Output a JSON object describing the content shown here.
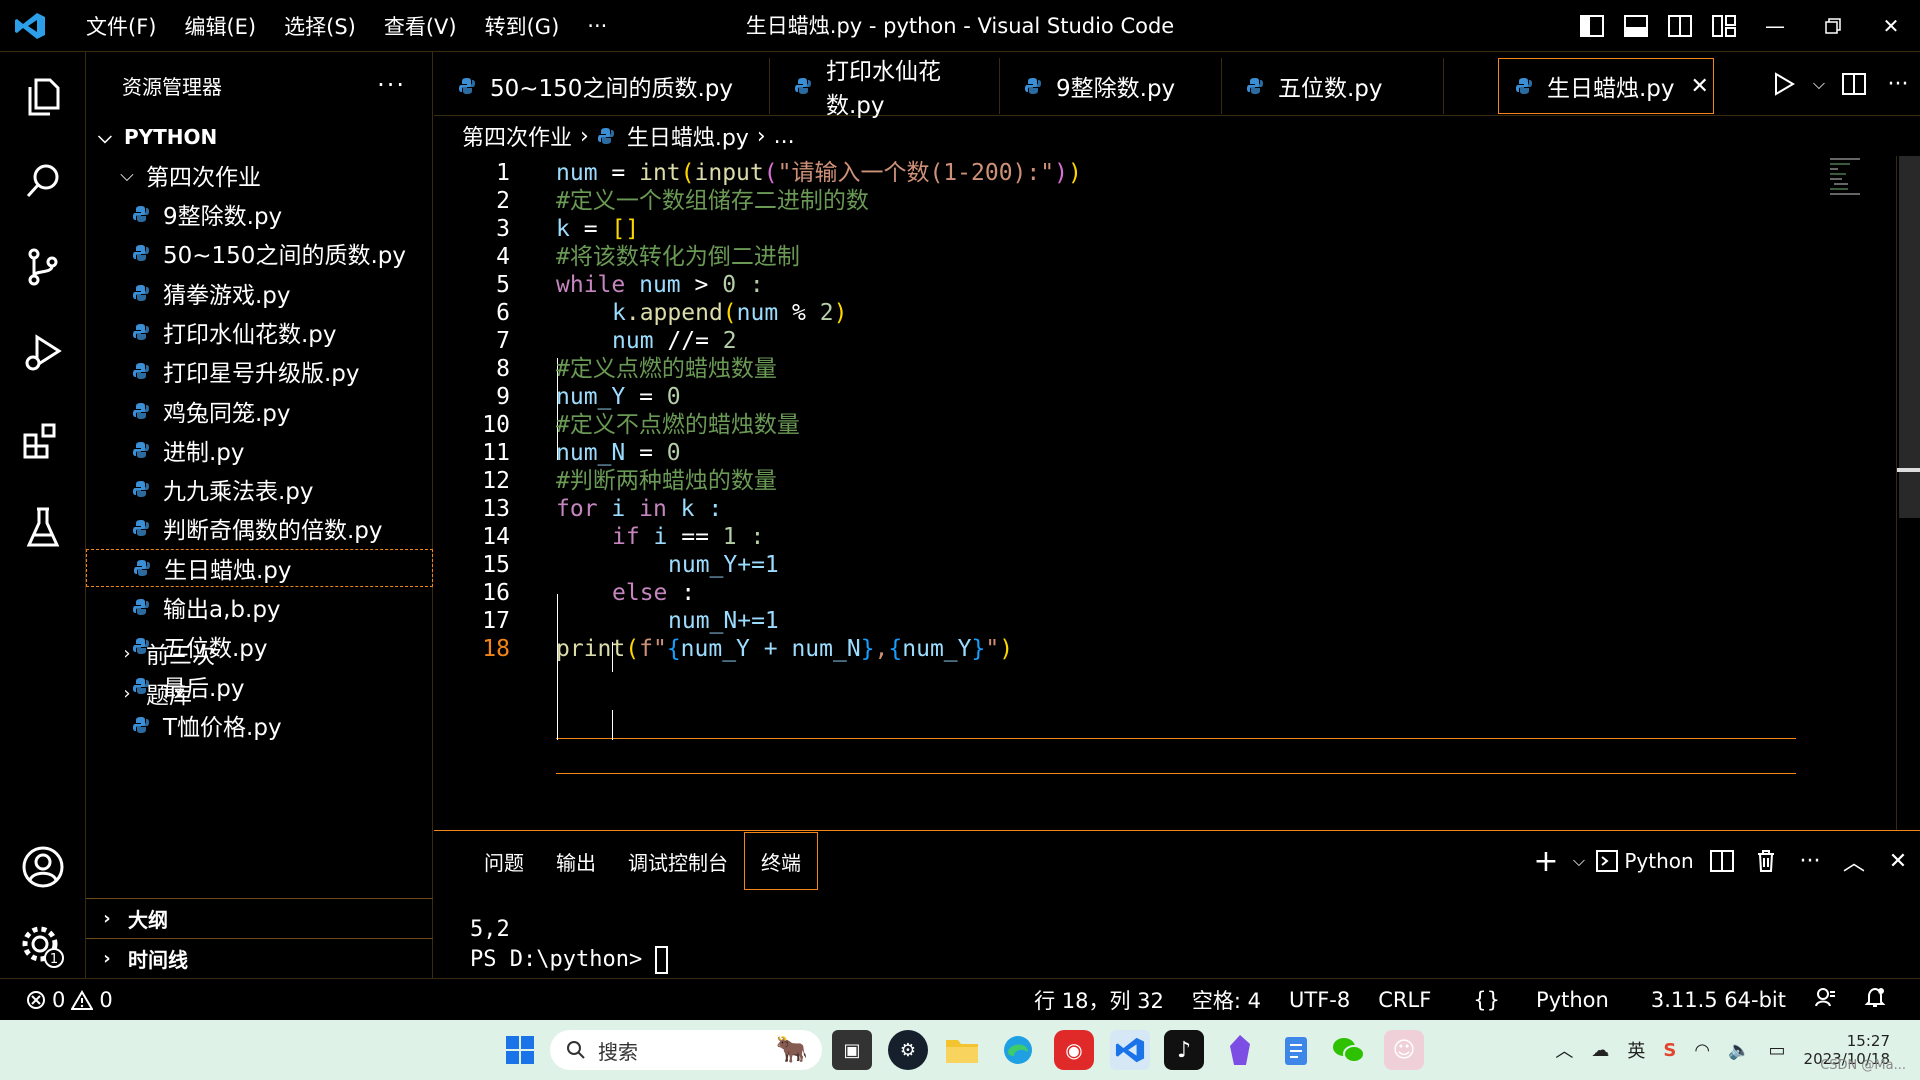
{
  "menu": [
    "文件(F)",
    "编辑(E)",
    "选择(S)",
    "查看(V)",
    "转到(G)",
    "···"
  ],
  "window_title": "生日蜡烛.py - python - Visual Studio Code",
  "explorer": {
    "header": "资源管理器",
    "more": "···",
    "root": "PYTHON",
    "folder_open": "第四次作业",
    "files": [
      "9整除数.py",
      "50~150之间的质数.py",
      "猜拳游戏.py",
      "打印水仙花数.py",
      "打印星号升级版.py",
      "鸡兔同笼.py",
      "进制.py",
      "九九乘法表.py",
      "判断奇偶数的倍数.py",
      "生日蜡烛.py",
      "输出a,b.py",
      "五位数.py",
      "最后.py",
      "T恤价格.py"
    ],
    "folders_closed": [
      "前三次",
      "题库"
    ],
    "sections": [
      "大纲",
      "时间线"
    ]
  },
  "tabs": [
    "50~150之间的质数.py",
    "打印水仙花数.py",
    "9整除数.py",
    "五位数.py",
    "生日蜡烛.py"
  ],
  "breadcrumb": {
    "folder": "第四次作业",
    "file": "生日蜡烛.py",
    "more": "..."
  },
  "code": {
    "line_numbers": [
      "1",
      "2",
      "3",
      "4",
      "5",
      "6",
      "7",
      "8",
      "9",
      "10",
      "11",
      "12",
      "13",
      "14",
      "15",
      "16",
      "17",
      "18"
    ],
    "l1": {
      "a": "num",
      "b": " = ",
      "c": "int",
      "d": "(",
      "e": "input",
      "f": "(",
      "g": "\"请输入一个数(1-200):\"",
      "h": ")",
      "i": ")"
    },
    "l2": "#定义一个数组储存二进制的数",
    "l3": {
      "a": "k",
      "b": " = ",
      "c": "[]"
    },
    "l4": "#将该数转化为倒二进制",
    "l5": {
      "a": "while",
      "b": " num ",
      "c": ">",
      "d": " 0 :"
    },
    "l6": {
      "a": "k",
      "b": ".append",
      "c": "(",
      "d": "num",
      "e": " % ",
      "f": "2",
      "g": ")"
    },
    "l7": {
      "a": "num",
      "b": " //= ",
      "c": "2"
    },
    "l8": "#定义点燃的蜡烛数量",
    "l9": {
      "a": "num_Y",
      "b": " = ",
      "c": "0"
    },
    "l10": "#定义不点燃的蜡烛数量",
    "l11": {
      "a": "num_N",
      "b": " = ",
      "c": "0"
    },
    "l12": "#判断两种蜡烛的数量",
    "l13": {
      "a": "for",
      "b": " i ",
      "c": "in",
      "d": " k :"
    },
    "l14": {
      "a": "if",
      "b": " i ",
      "c": "==",
      "d": " 1 :"
    },
    "l15": "num_Y+=1",
    "l16": {
      "a": "else",
      "b": " :"
    },
    "l17": "num_N+=1",
    "l18": {
      "a": "print",
      "b": "(",
      "c": "f\"",
      "d": "{",
      "e": "num_Y + num_N",
      "f": "}",
      "g": ",",
      "h": "{",
      "i": "num_Y",
      "j": "}",
      "k": "\"",
      "l": ")"
    }
  },
  "panel": {
    "tabs": [
      "问题",
      "输出",
      "调试控制台",
      "终端"
    ],
    "active_tab": "终端",
    "terminal_profile": "Python",
    "terminal_lines": [
      "5,2",
      "PS D:\\python> "
    ]
  },
  "status": {
    "errors": "0",
    "warnings": "0",
    "position": "行 18，列 32",
    "spaces": "空格: 4",
    "encoding": "UTF-8",
    "eol": "CRLF",
    "language": "Python",
    "interpreter": "3.11.5 64-bit"
  },
  "taskbar": {
    "search_placeholder": "搜索",
    "time": "15:27",
    "date": "2023/10/18",
    "watermark": "CSDN @Ma..."
  },
  "colors": {
    "accent": "#f38518",
    "keyword": "#c586c0",
    "function": "#dcdcaa",
    "variable": "#9cdcfe",
    "string": "#ce9178",
    "number": "#b5cea8",
    "comment": "#6a9955"
  }
}
